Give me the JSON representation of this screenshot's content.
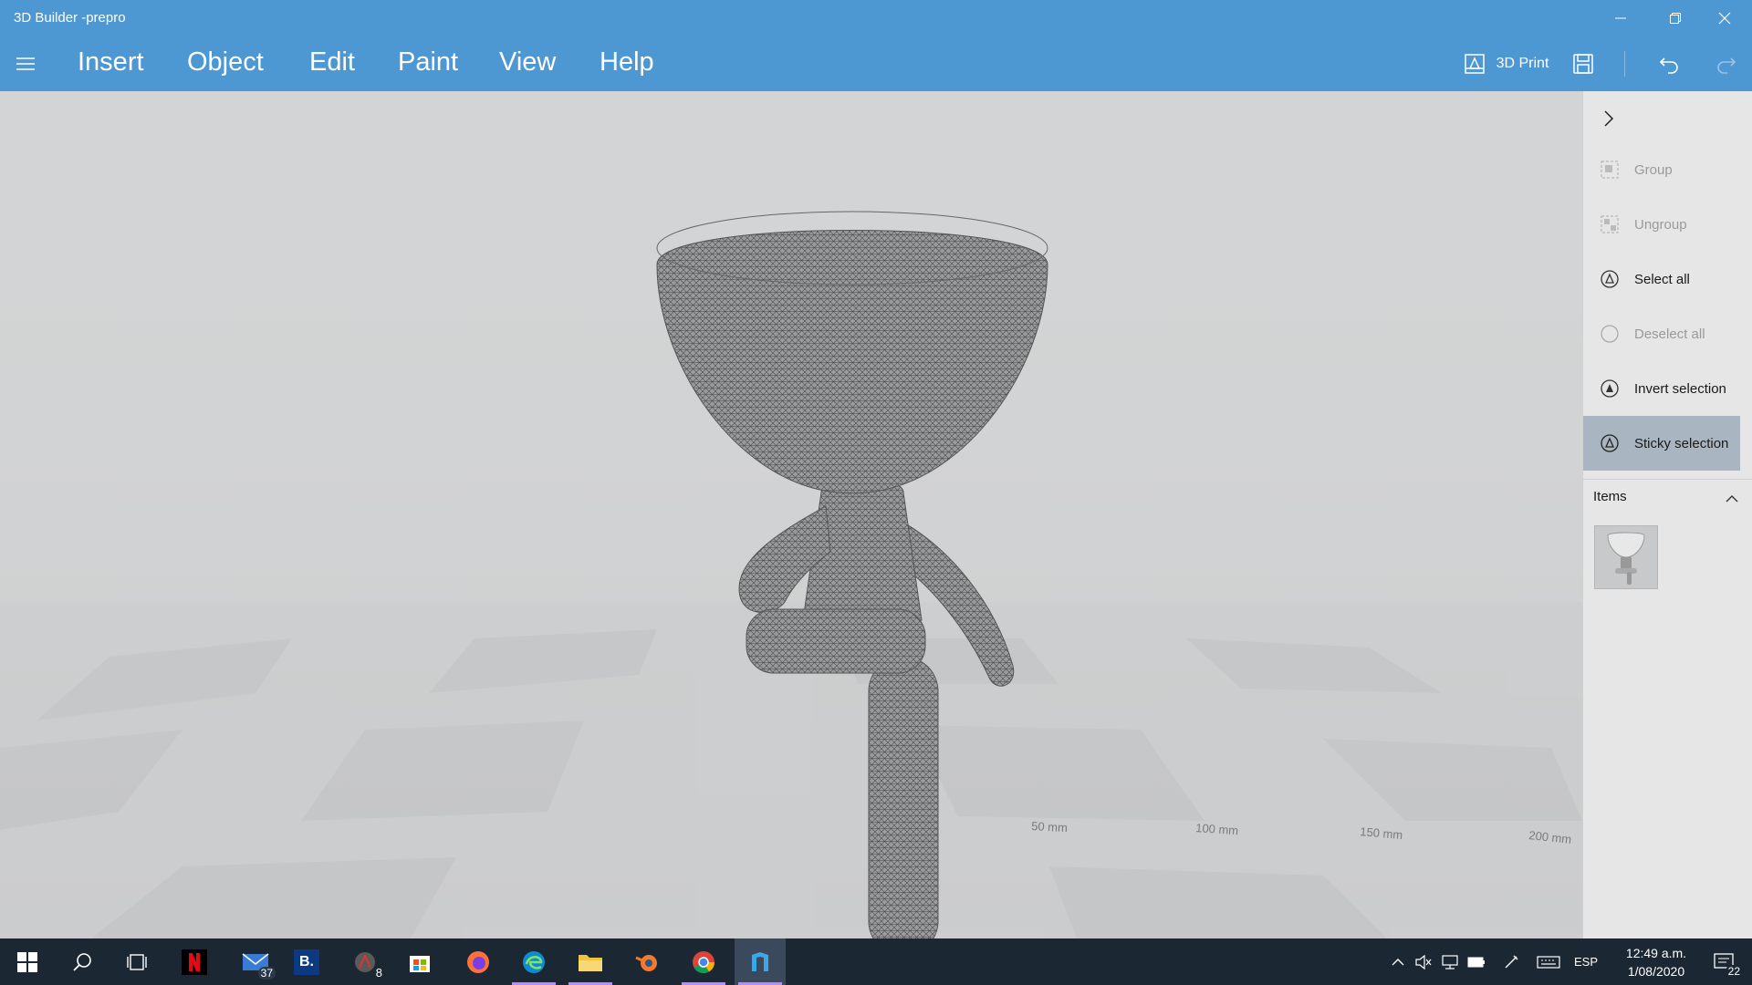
{
  "window": {
    "title": "3D Builder -prepro"
  },
  "menu": {
    "items": [
      "Insert",
      "Object",
      "Edit",
      "Paint",
      "View",
      "Help"
    ],
    "print_label": "3D Print"
  },
  "viewport": {
    "ruler_labels": [
      "50 mm",
      "100 mm",
      "150 mm",
      "200 mm"
    ]
  },
  "panel": {
    "actions": [
      {
        "label": "Group",
        "enabled": false,
        "icon": "group-icon"
      },
      {
        "label": "Ungroup",
        "enabled": false,
        "icon": "ungroup-icon"
      },
      {
        "label": "Select all",
        "enabled": true,
        "icon": "select-all-icon"
      },
      {
        "label": "Deselect all",
        "enabled": false,
        "icon": "deselect-all-icon"
      },
      {
        "label": "Invert selection",
        "enabled": true,
        "icon": "invert-selection-icon"
      },
      {
        "label": "Sticky selection",
        "enabled": true,
        "active": true,
        "icon": "sticky-selection-icon"
      }
    ],
    "items_label": "Items"
  },
  "taskbar": {
    "mail_badge": "37",
    "app_badge": "8",
    "bookmark_letter": "B.",
    "language": "ESP",
    "time": "12:49 a.m.",
    "date": "1/08/2020",
    "notifications": "22"
  },
  "colors": {
    "accent": "#4d97d2",
    "taskbar": "#1b2733",
    "panel": "#e6e6e6",
    "active_panel_item": "#a9b5c0"
  }
}
